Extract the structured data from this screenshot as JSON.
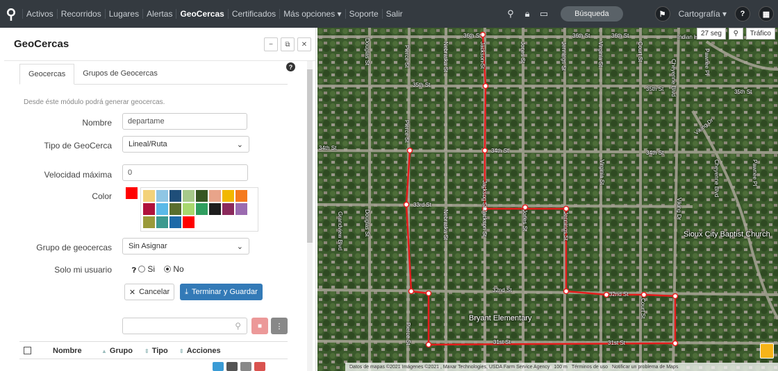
{
  "nav": {
    "items": [
      "Activos",
      "Recorridos",
      "Lugares",
      "Alertas",
      "GeoCercas",
      "Certificados",
      "Más opciones ▾",
      "Soporte",
      "Salir"
    ],
    "active_index": 4,
    "search_label": "Búsqueda",
    "cartografia_label": "Cartografía ▾",
    "help_label": "?"
  },
  "panel": {
    "title": "GeoCercas",
    "tabs": [
      "Geocercas",
      "Grupos de Geocercas"
    ],
    "description": "Desde éste módulo podrá generar geocercas.",
    "fields": {
      "nombre_label": "Nombre",
      "nombre_value": "departame",
      "tipo_label": "Tipo de GeoCerca",
      "tipo_value": "Lineal/Ruta",
      "velocidad_label": "Velocidad máxima",
      "velocidad_value": "0",
      "color_label": "Color",
      "grupo_label": "Grupo de geocercas",
      "grupo_value": "Sin Asignar",
      "solo_label": "Solo mi usuario",
      "si_label": "Si",
      "no_label": "No"
    },
    "selected_color": "#ff0000",
    "palette": [
      "#f3d27a",
      "#8fc6e4",
      "#1f4e79",
      "#a6c98a",
      "#375623",
      "#e8a48a",
      "#f2b800",
      "#f57a1e",
      "#b0123b",
      "#5ab9e8",
      "#5a6e2e",
      "#a8d86e",
      "#2f9e5f",
      "#1e1e1e",
      "#8b2a5c",
      "#9b6bb0",
      "#9a9a3a",
      "#3c9a8f",
      "#1e6aa8",
      "#ff0000"
    ],
    "buttons": {
      "cancel": "Cancelar",
      "save": "Terminar y Guardar"
    },
    "table": {
      "columns": [
        "Nombre",
        "Grupo",
        "Tipo",
        "Acciones"
      ]
    }
  },
  "map": {
    "timer": "27 seg",
    "traffic": "Tráfico",
    "church": "Sioux City Baptist Church",
    "school": "Bryant Elementary",
    "footer": [
      "Datos de mapas ©2021 Imágenes ©2021 , Maxar Technologies, USDA Farm Service Agency",
      "100 m",
      "Términos de uso",
      "Notificar un problema de Maps"
    ],
    "street_labels": {
      "s36_a": "36th St",
      "s36_b": "36th St",
      "s36_c": "36th St",
      "indian_hills": "Indian Hills Dr",
      "s35_a": "35th St",
      "s35_b": "35th St",
      "s35_c": "35th St",
      "s34_a": "34th St",
      "s34_b": "34th St",
      "s34_c": "34th St",
      "s33": "33rd St",
      "s32_a": "32nd St",
      "s32_b": "32nd St",
      "s31_a": "31st St",
      "s31_b": "31st St",
      "douglas_a": "Douglas St",
      "douglas_b": "Douglas St",
      "pierce_a": "Pierce St",
      "pierce_b": "Pierce St",
      "pierce_c": "Pierce St",
      "nebraska_a": "Nebraska St",
      "nebraska_b": "Nebraska St",
      "jackson_a": "Jackson St",
      "jackson_b": "Jackson St",
      "jackson_c": "Jackson St",
      "jones_a": "Jones St",
      "jones_b": "Jones St",
      "jennings_a": "Jennings St",
      "jennings_b": "Jennings St",
      "virginia_a": "Virginia St",
      "virginia_b": "Virginia St",
      "court_a": "Court St",
      "court_b": "Court St",
      "cheyenne_a": "Cheyenne Blvd",
      "cheyenne_b": "Cheyenne Blvd",
      "grandview": "Grandview Blvd",
      "viking_a": "Viking Dr",
      "viking_b": "Viking Dr",
      "pawnee_a": "Pawnee Pl",
      "pawnee_b": "Pawnee Pl"
    }
  }
}
